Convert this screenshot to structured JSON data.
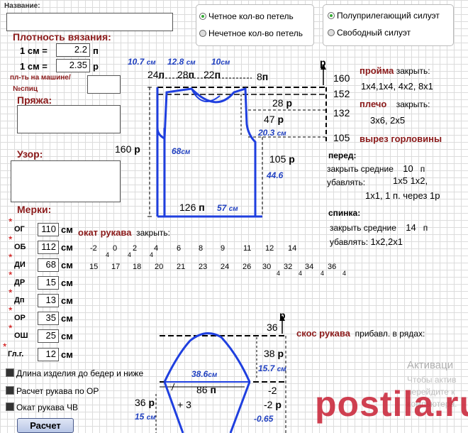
{
  "header": {
    "name_label": "Название:"
  },
  "density": {
    "title": "Плотность вязания:",
    "row1_label": "1 см =",
    "row1_value": "2.2",
    "row1_unit": "п",
    "row2_label": "1 см =",
    "row2_value": "2.35",
    "row2_unit": "р",
    "machine_label": "пл-ть на машине/",
    "needles_label": "№спиц"
  },
  "yarn": {
    "title": "Пряжа:"
  },
  "pattern": {
    "title": "Узор:"
  },
  "options": {
    "even_label": "Четное кол-во петель",
    "odd_label": "Нечетное кол-во петель",
    "semi_fit_label": "Полуприлегающий силуэт",
    "loose_label": "Свободный силуэт"
  },
  "measures": {
    "title": "Мерки:",
    "unit": "см",
    "rows": [
      {
        "label": "ОГ",
        "value": "110"
      },
      {
        "label": "ОБ",
        "value": "112"
      },
      {
        "label": "ДИ",
        "value": "68"
      },
      {
        "label": "ДР",
        "value": "15"
      },
      {
        "label": "Дп",
        "value": "13"
      },
      {
        "label": "ОР",
        "value": "35"
      },
      {
        "label": "ОШ",
        "value": "25"
      },
      {
        "label": "Гл.г.",
        "value": "12"
      }
    ]
  },
  "checks": {
    "hip_label": "Длина изделия до бедер и ниже",
    "sleeve_or_label": "Расчет рукава по ОР",
    "cap_label": "Окат рукава ЧВ"
  },
  "calc_button": "Расчет",
  "body_diagram": {
    "top_cm": [
      "10.7",
      "12.8",
      "10"
    ],
    "cm": "см",
    "top_st": [
      "24",
      "28",
      "22",
      "8"
    ],
    "p": "п",
    "r": "р",
    "R_head": "р",
    "right_rows": [
      "160",
      "152",
      "132",
      "105"
    ],
    "r28": "28",
    "r47": "47",
    "cm203": "20.3",
    "r105": "105",
    "cm446": "44.6",
    "left160": "160",
    "cm68": "68",
    "bottom_st": "126",
    "bottom_cm": "57"
  },
  "instructions": {
    "armhole_title": "пройма",
    "close_label": "закрыть:",
    "armhole_values": "1х4,1х4, 4х2, 8х1",
    "shoulder_title": "плечо",
    "shoulder_values": "3х6, 2х5",
    "neck_title": "вырез горловины",
    "front_label": "перед:",
    "close_mid_label": "закрыть средние",
    "front_mid": "10",
    "dec_label": "убавлять:",
    "front_dec1": "1х5 1х2,",
    "front_dec2": "1х1, 1 п. через 1р",
    "back_label": "спинка:",
    "back_mid": "14",
    "back_dec": "1х2,2х1"
  },
  "sleeve_cap": {
    "title": "окат рукава",
    "close_label": "закрыть:",
    "row1": [
      "-2",
      "0",
      "2",
      "4",
      "6",
      "8",
      "9",
      "11",
      "12",
      "14"
    ],
    "row1_sub": [
      "4",
      "4",
      "4"
    ],
    "row2": [
      "15",
      "17",
      "18",
      "20",
      "21",
      "23",
      "24",
      "26",
      "30",
      "32",
      "34",
      "36"
    ],
    "row2_sub": [
      "4",
      "4",
      "4",
      "4"
    ]
  },
  "sleeve_slope": {
    "title": "скос рукава",
    "add_label": "прибавл. в рядах:"
  },
  "sleeve_diagram": {
    "top36": "36",
    "p": "р",
    "r38": "38",
    "cm157": "15.7",
    "cm386": "38.6",
    "st86": "86",
    "m2a": "-2",
    "m2b": "-2",
    "plus3": "+ 3",
    "left36": "36",
    "cm15": "15",
    "cm065": "-0.65"
  },
  "watermark": {
    "activate": "Активаци",
    "line1": "Чтобы актив",
    "line2": "перейдите к",
    "line3": "компьютера.",
    "brand": "postila.ru"
  }
}
